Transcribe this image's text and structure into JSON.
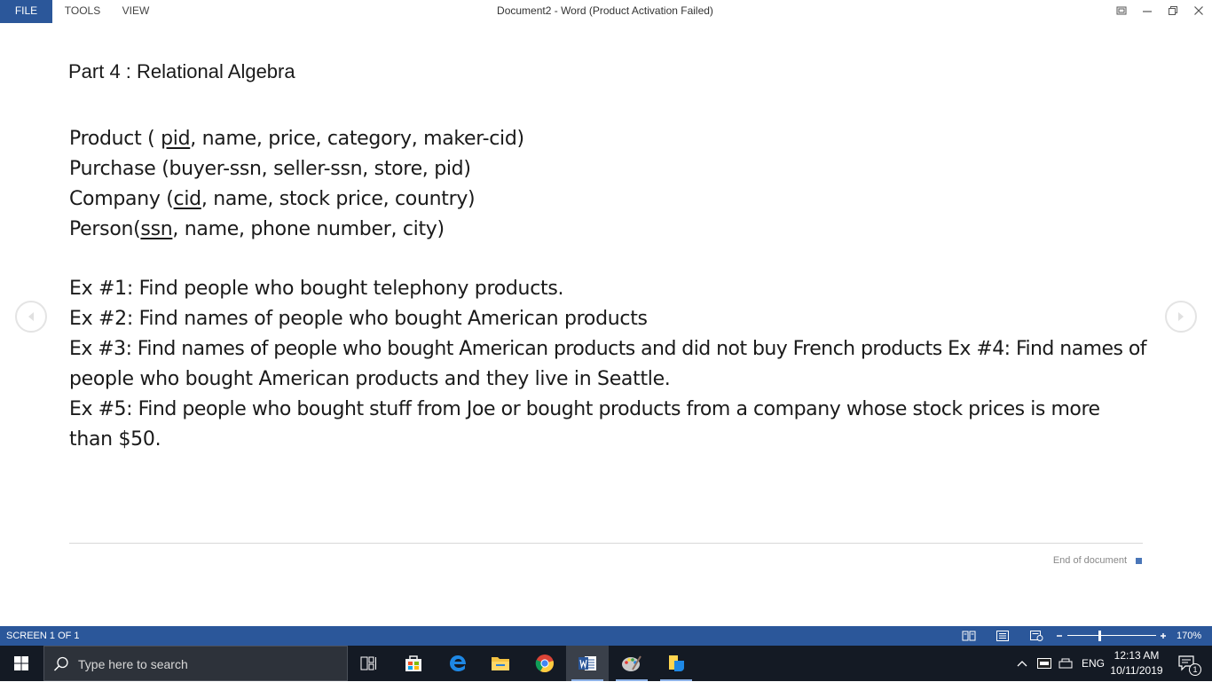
{
  "menubar": {
    "file": "FILE",
    "tools": "TOOLS",
    "view": "VIEW",
    "title": "Document2 - Word (Product Activation Failed)"
  },
  "document": {
    "heading": "Part 4 : Relational Algebra",
    "schema": {
      "product": {
        "prefix": "Product ( ",
        "key": "pid",
        "rest": ", name,  price, category, maker-cid)"
      },
      "purchase": {
        "text": "Purchase (buyer-ssn,  seller-ssn,  store,  pid)"
      },
      "company": {
        "prefix": "Company (",
        "key": "cid",
        "rest": ", name, stock price, country)"
      },
      "person": {
        "prefix": "Person(",
        "key": "ssn",
        "rest": ", name, phone number, city)"
      }
    },
    "exercises": [
      "Ex #1: Find people who bought telephony products.",
      "Ex #2: Find names of people who bought American products",
      "Ex #3: Find names of people who bought American products and did not buy French products Ex #4: Find names of",
      "people who bought American products and they live in Seattle.",
      "Ex #5: Find people who bought stuff from Joe or bought products from a company whose stock prices is more",
      "than $50."
    ],
    "end_label": "End of document"
  },
  "statusbar": {
    "screen": "SCREEN 1 OF 1",
    "zoom": "170%",
    "zoom_fraction": 0.36
  },
  "taskbar": {
    "search_placeholder": "Type here to search",
    "lang": "ENG",
    "time": "12:13 AM",
    "date": "10/11/2019",
    "notification_count": "1"
  },
  "colors": {
    "accent": "#2b579a",
    "taskbar": "#141a24"
  },
  "icons": [
    "restore-icon",
    "minimize-icon",
    "maximize-icon",
    "close-icon",
    "previous-screen-icon",
    "next-screen-icon",
    "read-mode-icon",
    "print-layout-icon",
    "web-layout-icon",
    "windows-start-icon",
    "search-icon",
    "task-view-icon",
    "store-icon",
    "edge-icon",
    "file-explorer-icon",
    "chrome-icon",
    "word-icon",
    "paint-icon",
    "sticky-app-icon",
    "chevron-up-icon",
    "ssd-icon",
    "network-icon",
    "notification-icon"
  ]
}
